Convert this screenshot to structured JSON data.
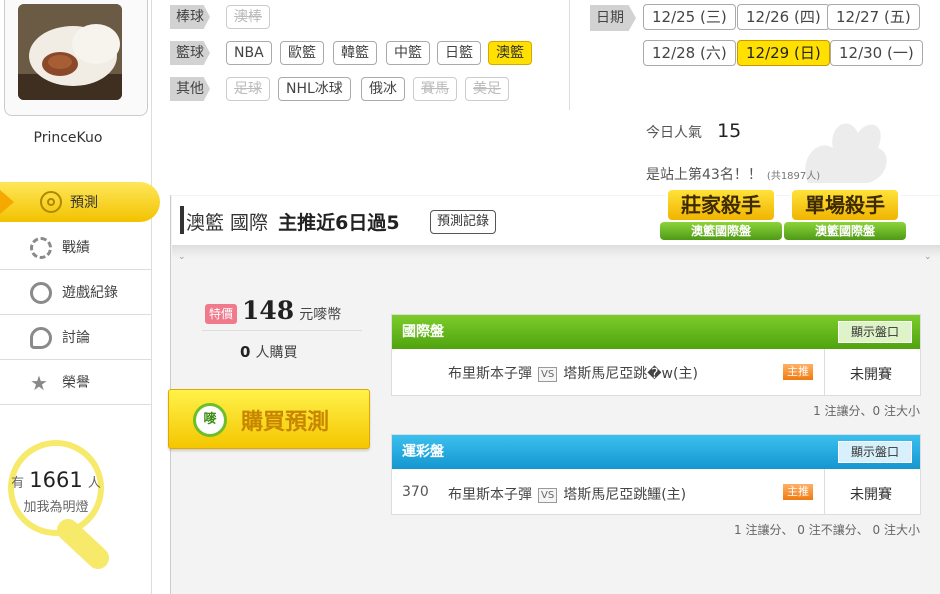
{
  "user": {
    "name": "PrinceKuo"
  },
  "nav": {
    "items": [
      {
        "label": "預測",
        "active": true
      },
      {
        "label": "戰績"
      },
      {
        "label": "遊戲紀錄"
      },
      {
        "label": "討論"
      },
      {
        "label": "榮譽"
      }
    ]
  },
  "fans": {
    "prefix": "有",
    "count": "1661",
    "unit": "人",
    "cta": "加我為明燈"
  },
  "filters": {
    "baseball": {
      "label": "棒球",
      "options": [
        "澳棒"
      ]
    },
    "basketball": {
      "label": "籃球",
      "options": [
        "NBA",
        "歐籃",
        "韓籃",
        "中籃",
        "日籃",
        "澳籃"
      ]
    },
    "other": {
      "label": "其他",
      "options": [
        "足球",
        "NHL冰球",
        "俄冰",
        "賽馬",
        "美足"
      ]
    }
  },
  "dates": {
    "label": "日期",
    "items": [
      "12/25 (三)",
      "12/26 (四)",
      "12/27 (五)",
      "12/28 (六)",
      "12/29 (日)",
      "12/30 (一)"
    ]
  },
  "popularity": {
    "label": "今日人氣",
    "value": "15",
    "rank_text": "是站上第43名！！",
    "rank_total": "(共1897人)"
  },
  "header": {
    "league": "澳籃 國際",
    "streak": "主推近6日過5",
    "records_button": "預測記錄"
  },
  "badges": [
    {
      "title": "莊家殺手",
      "sub": "澳籃國際盤"
    },
    {
      "title": "單場殺手",
      "sub": "澳籃國際盤"
    }
  ],
  "purchase": {
    "tag": "特價",
    "price": "148",
    "unit": "元嘜幣",
    "buyers": "0",
    "buyers_unit": "人購買",
    "button": "購買預測",
    "logo": "嘜"
  },
  "markets": [
    {
      "title": "國際盤",
      "show_button": "顯示盤口",
      "number": "",
      "away": "布里斯本子彈",
      "vs": "VS",
      "home": "塔斯馬尼亞跳�w(主)",
      "pick": "主推",
      "status": "未開賽",
      "summary": "1 注讓分、0 注大小",
      "color": "#5cb61c"
    },
    {
      "title": "運彩盤",
      "show_button": "顯示盤口",
      "number": "370",
      "away": "布里斯本子彈",
      "vs": "VS",
      "home": "塔斯馬尼亞跳鱷(主)",
      "pick": "主推",
      "status": "未開賽",
      "summary": "1 注讓分、 0 注不讓分、 0 注大小",
      "color": "#1aa6dd"
    }
  ]
}
